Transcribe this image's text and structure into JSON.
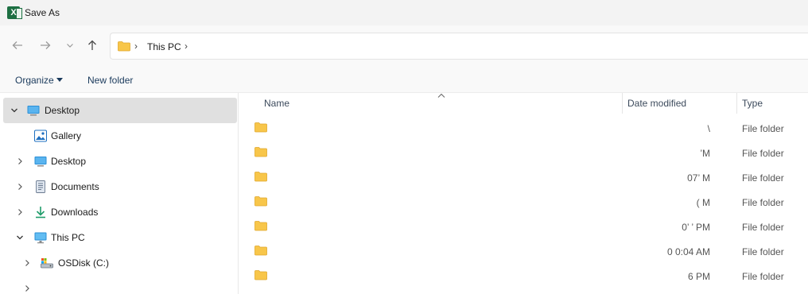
{
  "window": {
    "title": "Save As",
    "app_icon": "excel-icon",
    "app_icon_letter": "X"
  },
  "navigation": {
    "back_icon": "arrow-left-icon",
    "forward_icon": "arrow-right-icon",
    "recent_icon": "chevron-down-icon",
    "up_icon": "arrow-up-icon"
  },
  "address": {
    "segments": [
      "This PC"
    ],
    "separator": "›",
    "icon": "folder-icon"
  },
  "commands": {
    "organize_label": "Organize",
    "new_folder_label": "New folder"
  },
  "sidebar": {
    "items": [
      {
        "label": "Desktop",
        "icon": "desktop-icon",
        "expanded": true,
        "selected": true
      },
      {
        "label": "Gallery",
        "icon": "gallery-icon",
        "expanded": false,
        "selected": false
      },
      {
        "label": "Desktop",
        "icon": "desktop-icon",
        "expanded": false,
        "selected": false
      },
      {
        "label": "Documents",
        "icon": "documents-icon",
        "expanded": false,
        "selected": false
      },
      {
        "label": "Downloads",
        "icon": "downloads-icon",
        "expanded": false,
        "selected": false
      },
      {
        "label": "This PC",
        "icon": "computer-icon",
        "expanded": true,
        "selected": false
      },
      {
        "label": "OSDisk (C:)",
        "icon": "drive-icon",
        "expanded": false,
        "selected": false
      }
    ]
  },
  "columns": {
    "name": "Name",
    "date_modified": "Date modified",
    "type": "Type"
  },
  "files": [
    {
      "date": "\\",
      "type": "File folder"
    },
    {
      "date": "’M",
      "type": "File folder"
    },
    {
      "date": "07’           M",
      "type": "File folder"
    },
    {
      "date": "(                       M",
      "type": "File folder"
    },
    {
      "date": "0’             ’ PM",
      "type": "File folder"
    },
    {
      "date": "0              0:04 AM",
      "type": "File folder"
    },
    {
      "date": "6 PM",
      "type": "File folder"
    }
  ],
  "colors": {
    "folder": "#f8c64a",
    "selected_row": "#e0e0e0",
    "accent": "#1a3a5c"
  }
}
